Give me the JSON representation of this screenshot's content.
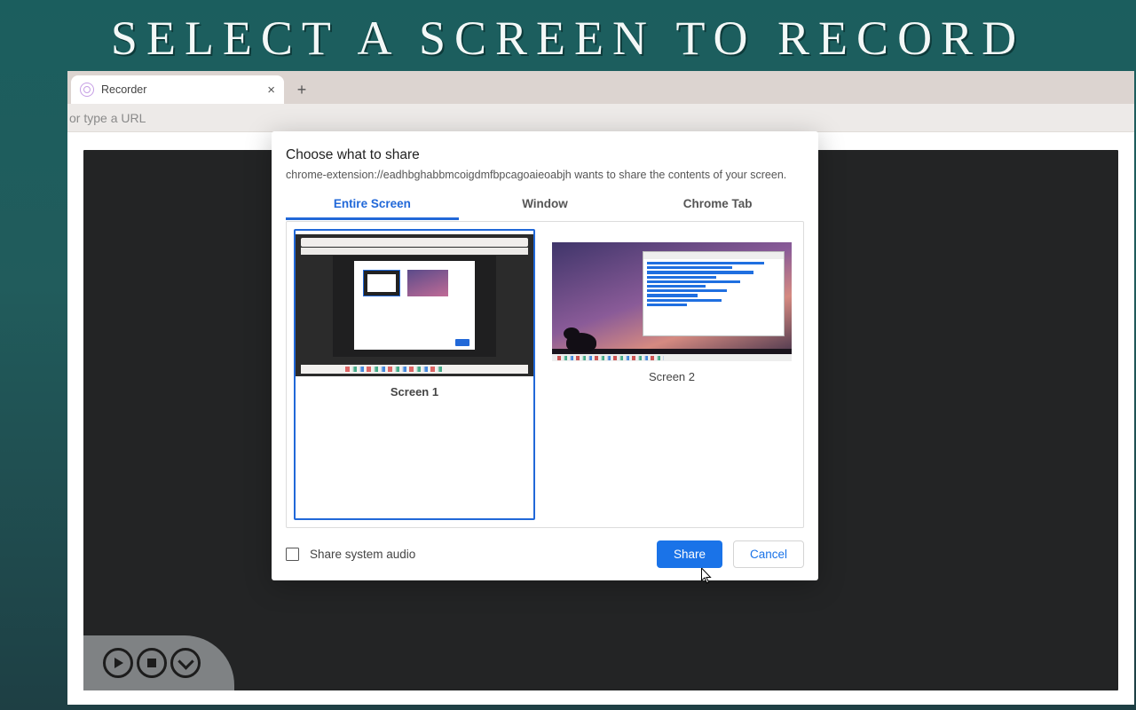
{
  "banner": {
    "title": "SELECT A SCREEN TO RECORD"
  },
  "browser": {
    "tab_title": "Recorder",
    "urlbar_text": "or type a URL"
  },
  "dialog": {
    "title": "Choose what to share",
    "subtitle": "chrome-extension://eadhbghabbmcoigdmfbpcagoaieoabjh wants to share the contents of your screen.",
    "tabs": [
      {
        "label": "Entire Screen",
        "active": true
      },
      {
        "label": "Window",
        "active": false
      },
      {
        "label": "Chrome Tab",
        "active": false
      }
    ],
    "screens": [
      {
        "label": "Screen 1",
        "selected": true
      },
      {
        "label": "Screen 2",
        "selected": false
      }
    ],
    "share_audio_label": "Share system audio",
    "share_button": "Share",
    "cancel_button": "Cancel"
  }
}
